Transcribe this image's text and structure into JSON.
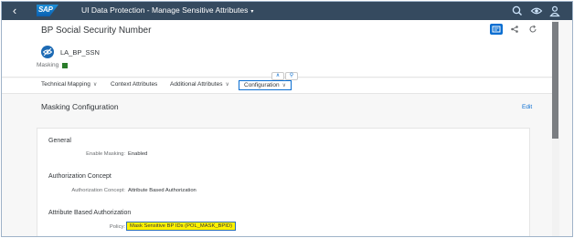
{
  "shell": {
    "app_title": "UI Data Protection - Manage Sensitive Attributes",
    "title_caret": "▾",
    "logo_text": "SAP",
    "icons": [
      "back-icon",
      "search-icon",
      "eye-icon",
      "user-icon"
    ]
  },
  "header": {
    "title": "BP Social Security Number",
    "subtitle": "LA_BP_SSN",
    "masking_label": "Masking",
    "masking_color": "#2b7d2b",
    "actions": [
      "edit-mode-icon",
      "share-icon",
      "refresh-icon"
    ]
  },
  "tabs": [
    {
      "label": "Technical Mapping",
      "chev": "∨"
    },
    {
      "label": "Context Attributes",
      "chev": ""
    },
    {
      "label": "Additional Attributes",
      "chev": "∨"
    },
    {
      "label": "Configuration",
      "chev": "∨",
      "selected": true
    }
  ],
  "section": {
    "title": "Masking Configuration",
    "edit_label": "Edit"
  },
  "groups": {
    "general": {
      "title": "General",
      "enable_masking_label": "Enable Masking:",
      "enable_masking_value": "Enabled"
    },
    "authorization": {
      "title": "Authorization Concept",
      "concept_label": "Authorization Concept:",
      "concept_value": "Attribute Based Authorization"
    },
    "attribute_based": {
      "title": "Attribute Based Authorization",
      "policy_label": "Policy:",
      "policy_value": "Mask Sensitive BP IDs (POL_MASK_BPID)"
    }
  },
  "colors": {
    "shell": "#354a5f",
    "accent": "#0a6ed1",
    "highlight": "#fff200"
  }
}
